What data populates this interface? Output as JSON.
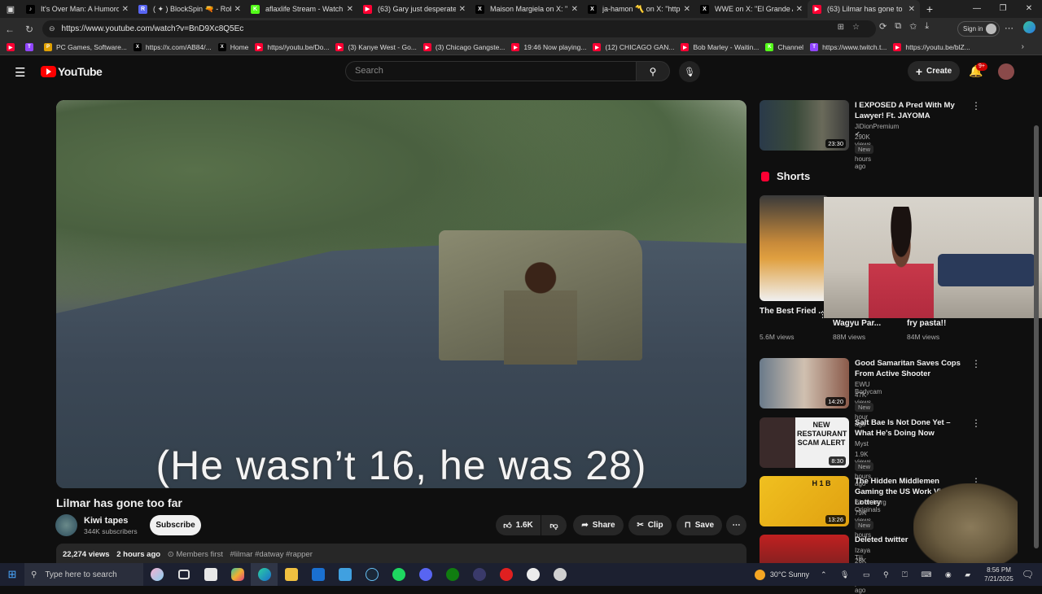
{
  "browser": {
    "tabs": [
      {
        "title": "It's Over Man: A Humorous",
        "color": "#000000",
        "glyph": "♪"
      },
      {
        "title": "( ✦ ) BlockSpin 🔫 - Roblox",
        "color": "#5865f2",
        "glyph": "R"
      },
      {
        "title": "aflaxlife Stream - Watch Liv",
        "color": "#53fc18",
        "glyph": "K"
      },
      {
        "title": "(63) Gary just desperate at",
        "color": "#ff0033",
        "glyph": "▶"
      },
      {
        "title": "Maison Margiela on X: \"@m",
        "color": "#000000",
        "glyph": "X"
      },
      {
        "title": "ja-hamon 〽️ on X: \"https:/",
        "color": "#000000",
        "glyph": "X"
      },
      {
        "title": "WWE on X: \"El Grande Ame",
        "color": "#000000",
        "glyph": "X"
      },
      {
        "title": "(63) Lilmar has gone to",
        "color": "#ff0033",
        "glyph": "▶",
        "active": true
      }
    ],
    "url": "https://www.youtube.com/watch?v=BnD9Xc8Q5Ec",
    "signin_label": "Sign in",
    "bookmarks": [
      {
        "label": "",
        "color": "#ff0033",
        "glyph": "▶"
      },
      {
        "label": "",
        "color": "#9146ff",
        "glyph": "T"
      },
      {
        "label": "PC Games, Software...",
        "color": "#e0a000",
        "glyph": "P"
      },
      {
        "label": "https://x.com/AB84/...",
        "color": "#000000",
        "glyph": "X"
      },
      {
        "label": "Home",
        "color": "#000000",
        "glyph": "X"
      },
      {
        "label": "https//youtu.be/Do...",
        "color": "#ff0033",
        "glyph": "▶"
      },
      {
        "label": "(3) Kanye West - Go...",
        "color": "#ff0033",
        "glyph": "▶"
      },
      {
        "label": "(3) Chicago Gangste...",
        "color": "#ff0033",
        "glyph": "▶"
      },
      {
        "label": "19:46 Now playing...",
        "color": "#ff0033",
        "glyph": "▶"
      },
      {
        "label": "(12) CHICAGO GAN...",
        "color": "#ff0033",
        "glyph": "▶"
      },
      {
        "label": "Bob Marley - Waitin...",
        "color": "#ff0033",
        "glyph": "▶"
      },
      {
        "label": "Channel",
        "color": "#53fc18",
        "glyph": "K"
      },
      {
        "label": "https://www.twitch.t...",
        "color": "#9146ff",
        "glyph": "T"
      },
      {
        "label": "https://youtu.be/blZ...",
        "color": "#ff0033",
        "glyph": "▶"
      }
    ]
  },
  "youtube": {
    "logo_text": "YouTube",
    "search_placeholder": "Search",
    "create_label": "Create",
    "notif_count": "9+",
    "video": {
      "subtitle": "(He wasn’t 16, he was 28)",
      "title": "Lilmar has gone too far",
      "channel": "Kiwi tapes",
      "subscribers": "344K subscribers",
      "subscribe_label": "Subscribe",
      "likes": "1.6K",
      "share_label": "Share",
      "clip_label": "Clip",
      "save_label": "Save",
      "views": "22,274 views",
      "age": "2 hours ago",
      "members": "Members first",
      "hashtags": "#lilmar #datway #rapper"
    },
    "recommended_top": {
      "title": "I EXPOSED A Pred With My Lawyer! Ft. JAYOMA",
      "channel": "JiDionPremium",
      "meta": "290K views • 3 hours ago",
      "duration": "23:30",
      "badge": "New"
    },
    "shorts_heading": "Shorts",
    "shorts": [
      {
        "title": "The Best Fried ...",
        "views": "5.6M views"
      },
      {
        "title": "Wagyu Par...",
        "views": "88M views"
      },
      {
        "title": "fry pasta!!",
        "views": "84M views"
      }
    ],
    "recommended": [
      {
        "title": "Good Samaritan Saves Cops From Active Shooter",
        "channel": "EWU Bodycam",
        "meta": "47K views • 1 hour ago",
        "duration": "14:20",
        "badge": "New"
      },
      {
        "title": "Salt Bae Is Not Done Yet – What He's Doing Now",
        "channel": "Myst",
        "meta": "1.9K views • 4 hours ago",
        "duration": "8:30",
        "badge": "New",
        "thumb_text": "NEW RESTAURANT SCAM ALERT"
      },
      {
        "title": "The Hidden Middlemen Gaming the US Work Visa Lottery",
        "channel": "Bloomberg Originals",
        "meta": "79K views • 16 hours",
        "duration": "13:26",
        "badge": "New",
        "thumb_text": "H 1 B"
      },
      {
        "title": "Deleted twitter",
        "channel": "Izaya Tiji",
        "meta": "26K views • 3 years ago",
        "duration": "",
        "badge": ""
      }
    ]
  },
  "taskbar": {
    "search_placeholder": "Type here to search",
    "weather": "30°C  Sunny",
    "time": "8:56 PM",
    "date": "7/21/2025"
  }
}
